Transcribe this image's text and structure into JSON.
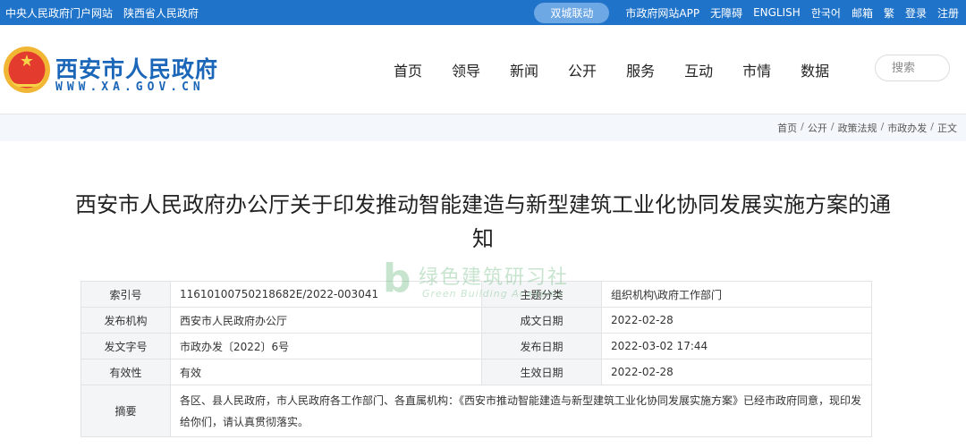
{
  "topbar": {
    "left_links": [
      "中央人民政府门户网站",
      "陕西省人民政府"
    ],
    "linkage": "双城联动",
    "right_links": [
      "市政府网站APP",
      "无障碍",
      "ENGLISH",
      "한국어",
      "邮箱",
      "繁",
      "登录",
      "注册"
    ]
  },
  "header": {
    "site_name": "西安市人民政府",
    "site_url": "WWW.XA.GOV.CN",
    "nav": [
      "首页",
      "领导",
      "新闻",
      "公开",
      "服务",
      "互动",
      "市情",
      "数据"
    ],
    "search_placeholder": "搜索"
  },
  "breadcrumb": [
    "首页",
    "公开",
    "政策法规",
    "市政办发",
    "正文"
  ],
  "article": {
    "title": "西安市人民政府办公厅关于印发推动智能建造与新型建筑工业化协同发展实施方案的通知"
  },
  "watermark": {
    "glyph": "b",
    "text_cn": "绿色建筑研习社",
    "text_en": "Green Building Academy"
  },
  "info": {
    "rows": [
      {
        "label1": "索引号",
        "value1": "11610100750218682E/2022-003041",
        "label2": "主题分类",
        "value2": "组织机构\\政府工作部门"
      },
      {
        "label1": "发布机构",
        "value1": "西安市人民政府办公厅",
        "label2": "成文日期",
        "value2": "2022-02-28"
      },
      {
        "label1": "发文字号",
        "value1": "市政办发〔2022〕6号",
        "label2": "发布日期",
        "value2": "2022-03-02 17:44"
      },
      {
        "label1": "有效性",
        "value1": "有效",
        "label2": "生效日期",
        "value2": "2022-02-28"
      }
    ],
    "summary_label": "摘要",
    "summary": "各区、县人民政府，市人民政府各工作部门、各直属机构：《西安市推动智能建造与新型建筑工业化协同发展实施方案》已经市政府同意，现印发给你们，请认真贯彻落实。"
  },
  "colors": {
    "topbar": "#1f73c9",
    "brand": "#1b66b8",
    "watermark": "#3aa155"
  }
}
